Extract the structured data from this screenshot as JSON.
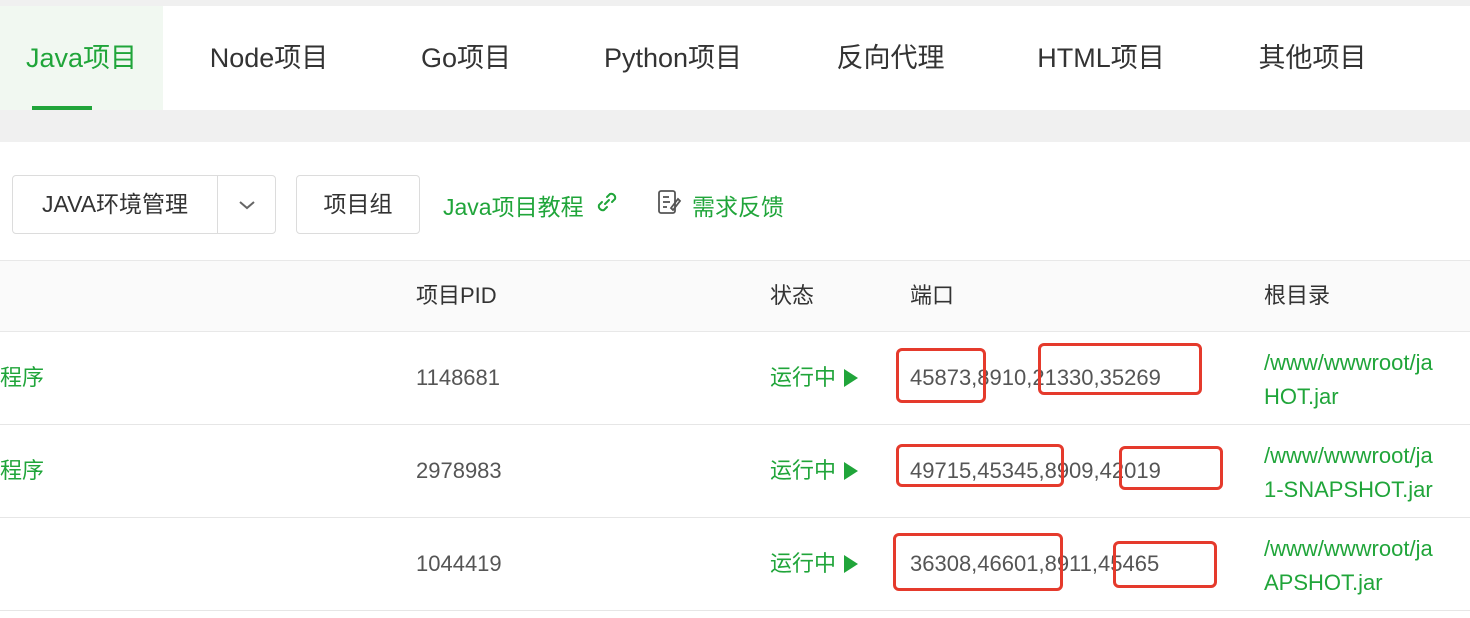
{
  "tabs": [
    {
      "label": "Java项目",
      "active": true
    },
    {
      "label": "Node项目"
    },
    {
      "label": "Go项目"
    },
    {
      "label": "Python项目"
    },
    {
      "label": "反向代理"
    },
    {
      "label": "HTML项目"
    },
    {
      "label": "其他项目"
    }
  ],
  "toolbar": {
    "env_label": "JAVA环境管理",
    "group_label": "项目组",
    "tutorial_label": "Java项目教程",
    "feedback_label": "需求反馈"
  },
  "table": {
    "headers": [
      "项目PID",
      "状态",
      "端口",
      "根目录"
    ],
    "rows": [
      {
        "name": "程序",
        "pid": "1148681",
        "status": "运行中",
        "ports": "45873,8910,21330,35269",
        "path_line1": "/www/wwwroot/ja",
        "path_line2": "HOT.jar"
      },
      {
        "name": "程序",
        "pid": "2978983",
        "status": "运行中",
        "ports": "49715,45345,8909,42019",
        "path_line1": "/www/wwwroot/ja",
        "path_line2": "1-SNAPSHOT.jar"
      },
      {
        "name": "",
        "pid": "1044419",
        "status": "运行中",
        "ports": "36308,46601,8911,45465",
        "path_line1": "/www/wwwroot/ja",
        "path_line2": "APSHOT.jar"
      }
    ]
  },
  "colors": {
    "accent": "#20a53a",
    "highlight": "#e53a2c"
  }
}
